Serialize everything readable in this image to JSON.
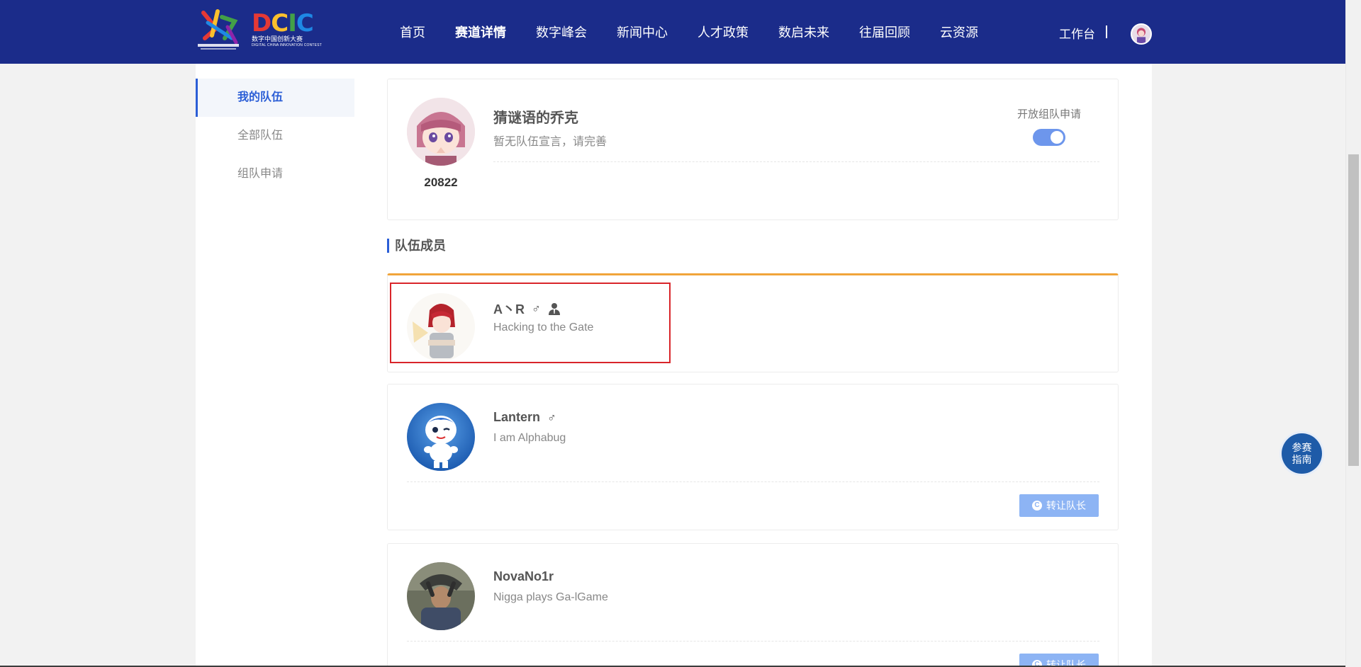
{
  "nav": {
    "logo_sub": "数字中国创新大赛",
    "logo_sub_en": "DIGITAL CHINA INNOVATION CONTEST",
    "logo_dcic": [
      "D",
      "C",
      "I",
      "C"
    ],
    "items": [
      {
        "label": "首页"
      },
      {
        "label": "赛道详情"
      },
      {
        "label": "数字峰会"
      },
      {
        "label": "新闻中心"
      },
      {
        "label": "人才政策"
      },
      {
        "label": "数启未来"
      },
      {
        "label": "往届回顾"
      },
      {
        "label": "云资源"
      }
    ],
    "active_index": 1,
    "workbench": "工作台"
  },
  "sidebar": {
    "items": [
      {
        "label": "我的队伍",
        "active": true
      },
      {
        "label": "全部队伍",
        "active": false
      },
      {
        "label": "组队申请",
        "active": false
      }
    ]
  },
  "team": {
    "name": "猜谜语的乔克",
    "declaration": "暂无队伍宣言，请完善",
    "id": "20822",
    "open_label": "开放组队申请",
    "open_enabled": true
  },
  "members_section": {
    "title": "队伍成员"
  },
  "members": [
    {
      "name": "A丶R",
      "gender": "♂",
      "captain": true,
      "motto": "Hacking to the Gate",
      "transfer_label": ""
    },
    {
      "name": "Lantern",
      "gender": "♂",
      "captain": false,
      "motto": "I am Alphabug",
      "transfer_label": "转让队长"
    },
    {
      "name": "NovaNo1r",
      "gender": "",
      "captain": false,
      "motto": "Nigga plays Ga-lGame",
      "transfer_label": "转让队长"
    }
  ],
  "guide": {
    "line1": "参赛",
    "line2": "指南"
  },
  "colors": {
    "nav_bg": "#1b2c8a",
    "accent": "#2b5ed6",
    "captain_border": "#f0a43a",
    "transfer_btn": "#8db4f4",
    "highlight": "#d9252a"
  }
}
